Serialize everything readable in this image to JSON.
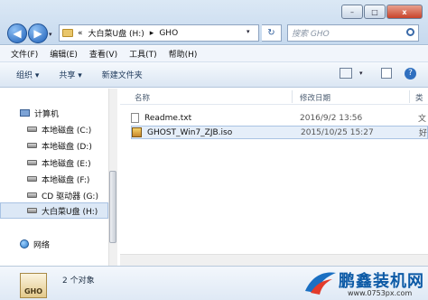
{
  "address": {
    "back_glyph": "◀",
    "forward_glyph": "▶",
    "breadcrumb_sep": "«",
    "crumbs": [
      "大白菜U盘 (H:)",
      "▸",
      "GHO"
    ],
    "dropdown_glyph": "▾",
    "refresh_glyph": "↻",
    "search_placeholder": "搜索 GHO"
  },
  "window_buttons": {
    "minimize": "–",
    "maximize": "□",
    "close": "x"
  },
  "menu": [
    "文件(F)",
    "编辑(E)",
    "查看(V)",
    "工具(T)",
    "帮助(H)"
  ],
  "toolbar": {
    "organize": "组织 ▾",
    "share": "共享 ▾",
    "new_folder": "新建文件夹"
  },
  "sidebar": {
    "computer": "计算机",
    "drives": [
      {
        "label": "本地磁盘 (C:)"
      },
      {
        "label": "本地磁盘 (D:)"
      },
      {
        "label": "本地磁盘 (E:)"
      },
      {
        "label": "本地磁盘 (F:)"
      },
      {
        "label": "CD 驱动器 (G:)"
      },
      {
        "label": "大白菜U盘 (H:)"
      }
    ],
    "network": "网络"
  },
  "columns": {
    "name": "名称",
    "date": "修改日期",
    "type": "类"
  },
  "files": [
    {
      "name": "Readme.txt",
      "date": "2016/9/2 13:56",
      "type": "文"
    },
    {
      "name": "GHOST_Win7_ZJB.iso",
      "date": "2015/10/25 15:27",
      "type": "好"
    }
  ],
  "status": {
    "count": "2 个对象",
    "icon_label": "GHO"
  },
  "watermark": {
    "brand": "鹏鑫装机网",
    "url": "www.0753px.com"
  }
}
